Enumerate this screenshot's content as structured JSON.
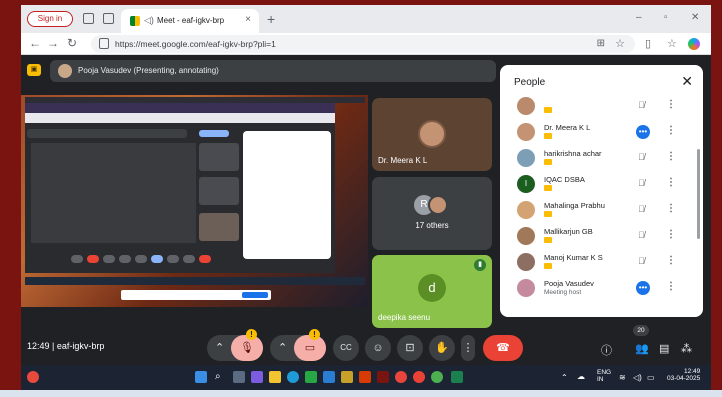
{
  "browser": {
    "signin_label": "Sign in",
    "tab_title": "Meet - eaf-igkv-brp",
    "tab_close": "×",
    "new_tab": "+",
    "minimize": "–",
    "restore": "▫",
    "close": "✕",
    "url": "https://meet.google.com/eaf-igkv-brp?pli=1"
  },
  "meet": {
    "presenter_text": "Pooja Vasudev (Presenting, annotating)",
    "tiles": [
      {
        "name": "Dr. Meera K L"
      },
      {
        "name": "17 others",
        "initial": "R"
      },
      {
        "name": "deepika seenu",
        "initial": "d"
      }
    ],
    "people_panel": {
      "title": "People",
      "close": "✕",
      "participants": [
        {
          "name": "",
          "badge": true,
          "action": "mic-off"
        },
        {
          "name": "Dr. Meera K L",
          "badge": true,
          "action": "active"
        },
        {
          "name": "harikrishna achar",
          "badge": true,
          "action": "mic-off"
        },
        {
          "name": "IQAC DSBA",
          "initial": "I",
          "badge": true,
          "action": "mic-off"
        },
        {
          "name": "Mahalinga Prabhu",
          "badge": true,
          "action": "mic-off"
        },
        {
          "name": "Mallikarjun GB",
          "badge": true,
          "action": "mic-off"
        },
        {
          "name": "Manoj Kumar K S",
          "badge": true,
          "action": "mic-off"
        },
        {
          "name": "Pooja Vasudev",
          "subtitle": "Meeting host",
          "action": "active"
        }
      ]
    },
    "bottom": {
      "time": "12:49",
      "separator": "|",
      "meeting_code": "eaf-igkv-brp",
      "participant_count": "20"
    }
  },
  "taskbar": {
    "lang_line1": "ENG",
    "lang_line2": "IN",
    "time": "12:49",
    "date": "03-04-2025"
  },
  "colors": {
    "frame": "#7a1410",
    "meet_bg": "#202124",
    "end_call": "#ea4335",
    "accent_blue": "#1a73e8",
    "badge_yellow": "#fbbc04"
  }
}
